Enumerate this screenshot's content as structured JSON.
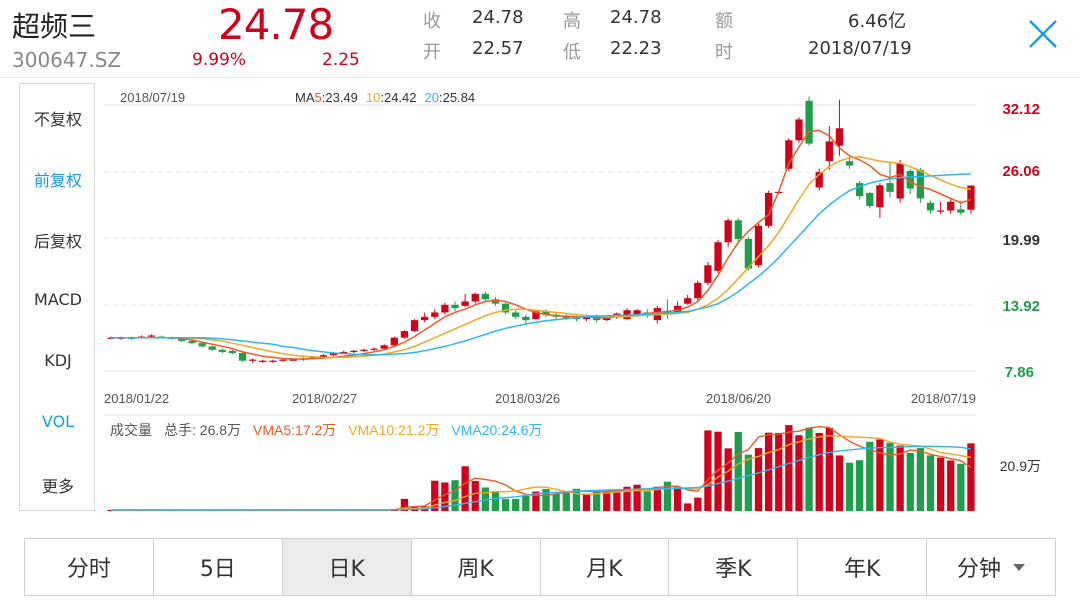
{
  "header": {
    "name": "超频三",
    "code": "300647.SZ",
    "price": "24.78",
    "change_pct": "9.99%",
    "change": "2.25",
    "quotes": [
      {
        "label": "收",
        "value": "24.78"
      },
      {
        "label": "高",
        "value": "24.78"
      },
      {
        "label": "额",
        "value": "6.46亿"
      },
      {
        "label": "开",
        "value": "22.57"
      },
      {
        "label": "低",
        "value": "22.23"
      },
      {
        "label": "时",
        "value": "2018/07/19"
      }
    ],
    "close_icon": "close-icon"
  },
  "sidebar": {
    "items": [
      {
        "label": "不复权",
        "active": false
      },
      {
        "label": "前复权",
        "active": true
      },
      {
        "label": "后复权",
        "active": false
      },
      {
        "label": "MACD",
        "active": false
      },
      {
        "label": "KDJ",
        "active": false
      },
      {
        "label": "VOL",
        "active": true
      },
      {
        "label": "更多",
        "active": false
      }
    ]
  },
  "ma_legend": {
    "date": "2018/07/19",
    "ma5_prefix": "MA",
    "ma5_label": "5",
    "ma5_value": ":23.49",
    "ma10_label": "10",
    "ma10_value": ":24.42",
    "ma20_label": "20",
    "ma20_value": ":25.84"
  },
  "vol_legend": {
    "title": "成交量",
    "hands": "总手: 26.8万",
    "vma5": "VMA5:17.2万",
    "vma10": "VMA10:21.2万",
    "vma20": "VMA20:24.6万"
  },
  "tabs": [
    "分时",
    "5日",
    "日K",
    "周K",
    "月K",
    "季K",
    "年K",
    "分钟"
  ],
  "selected_tab": "日K",
  "colors": {
    "up": "#d0021b",
    "down": "#1e9e4a",
    "ma5": "#ee5a24",
    "ma10": "#f5a623",
    "ma20": "#2db7f5",
    "accent": "#1a9cde"
  },
  "chart_data": {
    "type": "candlestick",
    "y_axis_labels": [
      "32.12",
      "26.06",
      "19.99",
      "13.92",
      "7.86"
    ],
    "ylim": [
      7.86,
      32.12
    ],
    "volume_axis_label": "20.9万",
    "x_axis_labels": [
      "2018/01/22",
      "2018/02/27",
      "2018/03/26",
      "2018/06/20",
      "2018/07/19"
    ],
    "candles": [
      {
        "o": 10.9,
        "c": 10.9,
        "h": 11.0,
        "l": 10.8
      },
      {
        "o": 10.8,
        "c": 10.9,
        "h": 11.0,
        "l": 10.7
      },
      {
        "o": 10.9,
        "c": 10.8,
        "h": 11.0,
        "l": 10.7
      },
      {
        "o": 10.9,
        "c": 11.0,
        "h": 11.1,
        "l": 10.8
      },
      {
        "o": 11.0,
        "c": 11.1,
        "h": 11.2,
        "l": 10.9
      },
      {
        "o": 11.0,
        "c": 10.9,
        "h": 11.1,
        "l": 10.8
      },
      {
        "o": 10.9,
        "c": 10.8,
        "h": 11.0,
        "l": 10.7
      },
      {
        "o": 10.8,
        "c": 10.6,
        "h": 10.9,
        "l": 10.5
      },
      {
        "o": 10.6,
        "c": 10.4,
        "h": 10.7,
        "l": 10.3
      },
      {
        "o": 10.4,
        "c": 10.1,
        "h": 10.5,
        "l": 10.0
      },
      {
        "o": 10.1,
        "c": 9.8,
        "h": 10.2,
        "l": 9.7
      },
      {
        "o": 9.8,
        "c": 9.6,
        "h": 9.9,
        "l": 9.5
      },
      {
        "o": 9.7,
        "c": 9.5,
        "h": 9.8,
        "l": 9.4
      },
      {
        "o": 9.5,
        "c": 8.8,
        "h": 9.6,
        "l": 8.7
      },
      {
        "o": 8.8,
        "c": 8.9,
        "h": 9.0,
        "l": 8.6
      },
      {
        "o": 8.8,
        "c": 8.8,
        "h": 8.9,
        "l": 8.6
      },
      {
        "o": 8.7,
        "c": 8.8,
        "h": 8.9,
        "l": 8.6
      },
      {
        "o": 8.8,
        "c": 8.9,
        "h": 9.0,
        "l": 8.7
      },
      {
        "o": 8.9,
        "c": 8.9,
        "h": 9.0,
        "l": 8.8
      },
      {
        "o": 8.9,
        "c": 9.0,
        "h": 9.1,
        "l": 8.8
      },
      {
        "o": 9.0,
        "c": 9.1,
        "h": 9.2,
        "l": 8.9
      },
      {
        "o": 9.1,
        "c": 9.3,
        "h": 9.4,
        "l": 9.0
      },
      {
        "o": 9.3,
        "c": 9.5,
        "h": 9.6,
        "l": 9.2
      },
      {
        "o": 9.5,
        "c": 9.6,
        "h": 9.7,
        "l": 9.4
      },
      {
        "o": 9.6,
        "c": 9.7,
        "h": 9.8,
        "l": 9.5
      },
      {
        "o": 9.7,
        "c": 9.8,
        "h": 9.9,
        "l": 9.6
      },
      {
        "o": 9.8,
        "c": 9.9,
        "h": 10.0,
        "l": 9.7
      },
      {
        "o": 9.9,
        "c": 10.2,
        "h": 10.3,
        "l": 9.8
      },
      {
        "o": 10.2,
        "c": 10.9,
        "h": 11.0,
        "l": 10.1
      },
      {
        "o": 10.9,
        "c": 11.5,
        "h": 11.6,
        "l": 10.8
      },
      {
        "o": 11.5,
        "c": 12.5,
        "h": 12.6,
        "l": 11.4
      },
      {
        "o": 12.5,
        "c": 12.8,
        "h": 13.2,
        "l": 12.3
      },
      {
        "o": 12.8,
        "c": 13.2,
        "h": 13.5,
        "l": 12.6
      },
      {
        "o": 13.2,
        "c": 13.9,
        "h": 14.1,
        "l": 13.0
      },
      {
        "o": 13.9,
        "c": 13.6,
        "h": 14.2,
        "l": 13.3
      },
      {
        "o": 13.8,
        "c": 14.2,
        "h": 14.9,
        "l": 13.7
      },
      {
        "o": 14.2,
        "c": 14.9,
        "h": 15.0,
        "l": 14.0
      },
      {
        "o": 14.9,
        "c": 14.4,
        "h": 15.1,
        "l": 14.2
      },
      {
        "o": 14.4,
        "c": 14.0,
        "h": 14.6,
        "l": 13.8
      },
      {
        "o": 14.0,
        "c": 13.2,
        "h": 14.1,
        "l": 13.0
      },
      {
        "o": 13.2,
        "c": 12.8,
        "h": 13.4,
        "l": 12.6
      },
      {
        "o": 12.8,
        "c": 12.5,
        "h": 13.0,
        "l": 12.1
      },
      {
        "o": 12.6,
        "c": 13.3,
        "h": 13.4,
        "l": 12.5
      },
      {
        "o": 13.3,
        "c": 13.0,
        "h": 13.5,
        "l": 12.8
      },
      {
        "o": 13.0,
        "c": 12.8,
        "h": 13.2,
        "l": 12.6
      },
      {
        "o": 12.9,
        "c": 12.7,
        "h": 13.0,
        "l": 12.5
      },
      {
        "o": 12.7,
        "c": 12.6,
        "h": 12.9,
        "l": 12.4
      },
      {
        "o": 12.6,
        "c": 12.9,
        "h": 13.0,
        "l": 12.4
      },
      {
        "o": 12.9,
        "c": 12.5,
        "h": 13.0,
        "l": 12.3
      },
      {
        "o": 12.5,
        "c": 12.8,
        "h": 12.9,
        "l": 12.4
      },
      {
        "o": 12.8,
        "c": 13.1,
        "h": 13.2,
        "l": 12.6
      },
      {
        "o": 12.6,
        "c": 13.4,
        "h": 13.6,
        "l": 12.5
      },
      {
        "o": 12.9,
        "c": 13.4,
        "h": 13.5,
        "l": 12.8
      },
      {
        "o": 13.2,
        "c": 13.0,
        "h": 13.5,
        "l": 12.7
      },
      {
        "o": 12.5,
        "c": 13.6,
        "h": 13.8,
        "l": 12.2
      },
      {
        "o": 13.3,
        "c": 13.1,
        "h": 14.4,
        "l": 12.6
      },
      {
        "o": 13.2,
        "c": 13.8,
        "h": 14.2,
        "l": 13.1
      },
      {
        "o": 14.0,
        "c": 14.5,
        "h": 14.8,
        "l": 13.9
      },
      {
        "o": 14.5,
        "c": 15.9,
        "h": 16.1,
        "l": 14.3
      },
      {
        "o": 15.9,
        "c": 17.5,
        "h": 17.8,
        "l": 15.7
      },
      {
        "o": 17.0,
        "c": 19.6,
        "h": 19.8,
        "l": 16.8
      },
      {
        "o": 19.6,
        "c": 21.6,
        "h": 21.8,
        "l": 19.2
      },
      {
        "o": 21.6,
        "c": 19.9,
        "h": 21.8,
        "l": 19.6
      },
      {
        "o": 19.9,
        "c": 17.2,
        "h": 20.1,
        "l": 17.0
      },
      {
        "o": 17.5,
        "c": 21.1,
        "h": 21.3,
        "l": 17.3
      },
      {
        "o": 21.1,
        "c": 24.1,
        "h": 24.3,
        "l": 20.9
      },
      {
        "o": 24.1,
        "c": 24.2,
        "h": 24.3,
        "l": 24.0
      },
      {
        "o": 26.3,
        "c": 28.9,
        "h": 29.1,
        "l": 26.1
      },
      {
        "o": 28.9,
        "c": 30.8,
        "h": 31.0,
        "l": 28.7
      },
      {
        "o": 32.5,
        "c": 28.6,
        "h": 32.9,
        "l": 28.4
      },
      {
        "o": 24.6,
        "c": 26.0,
        "h": 26.3,
        "l": 24.3
      },
      {
        "o": 27.0,
        "c": 28.8,
        "h": 30.2,
        "l": 26.2
      },
      {
        "o": 28.4,
        "c": 30.0,
        "h": 32.6,
        "l": 27.5
      },
      {
        "o": 27.0,
        "c": 26.6,
        "h": 27.3,
        "l": 26.3
      },
      {
        "o": 25.0,
        "c": 23.8,
        "h": 25.2,
        "l": 23.5
      },
      {
        "o": 24.1,
        "c": 22.9,
        "h": 24.2,
        "l": 22.7
      },
      {
        "o": 22.8,
        "c": 24.8,
        "h": 25.0,
        "l": 21.8
      },
      {
        "o": 25.0,
        "c": 24.2,
        "h": 26.9,
        "l": 23.7
      },
      {
        "o": 23.6,
        "c": 26.8,
        "h": 27.1,
        "l": 23.2
      },
      {
        "o": 26.1,
        "c": 24.5,
        "h": 26.3,
        "l": 24.0
      },
      {
        "o": 26.2,
        "c": 23.6,
        "h": 26.4,
        "l": 23.2
      },
      {
        "o": 23.2,
        "c": 22.5,
        "h": 23.4,
        "l": 22.2
      },
      {
        "o": 22.5,
        "c": 22.5,
        "h": 23.3,
        "l": 22.2
      },
      {
        "o": 22.5,
        "c": 23.3,
        "h": 23.5,
        "l": 22.2
      },
      {
        "o": 22.6,
        "c": 22.3,
        "h": 23.4,
        "l": 22.1
      },
      {
        "o": 22.57,
        "c": 24.78,
        "h": 24.78,
        "l": 22.23
      }
    ],
    "ma5": [
      10.9,
      10.9,
      10.9,
      10.9,
      10.9,
      10.9,
      10.9,
      10.8,
      10.7,
      10.5,
      10.3,
      10.1,
      9.9,
      9.6,
      9.4,
      9.2,
      9.1,
      9.0,
      8.95,
      8.95,
      9.0,
      9.05,
      9.1,
      9.2,
      9.3,
      9.45,
      9.6,
      9.8,
      10.1,
      10.5,
      11.0,
      11.6,
      12.2,
      12.8,
      13.2,
      13.5,
      13.9,
      14.2,
      14.3,
      14.2,
      13.9,
      13.5,
      13.2,
      13.0,
      12.9,
      12.85,
      12.8,
      12.8,
      12.7,
      12.7,
      12.8,
      12.9,
      13.0,
      13.1,
      13.2,
      13.3,
      13.4,
      13.7,
      14.2,
      15.2,
      16.6,
      18.2,
      19.6,
      20.6,
      21.4,
      22.1,
      24.2,
      26.8,
      28.3,
      29.7,
      29.8,
      29.3,
      28.2,
      27.5,
      27.1,
      26.6,
      25.8,
      25.5,
      25.8,
      25.1,
      24.7,
      24.4,
      24.0,
      23.6,
      23.2,
      23.49
    ],
    "ma10": [
      10.9,
      10.9,
      10.9,
      10.9,
      10.9,
      10.9,
      10.9,
      10.9,
      10.85,
      10.8,
      10.7,
      10.6,
      10.4,
      10.2,
      10.0,
      9.8,
      9.6,
      9.45,
      9.3,
      9.2,
      9.15,
      9.1,
      9.1,
      9.1,
      9.15,
      9.2,
      9.3,
      9.4,
      9.6,
      9.8,
      10.1,
      10.5,
      10.9,
      11.3,
      11.7,
      12.1,
      12.5,
      12.9,
      13.2,
      13.4,
      13.5,
      13.5,
      13.4,
      13.3,
      13.2,
      13.1,
      13.0,
      12.9,
      12.9,
      12.8,
      12.8,
      12.8,
      12.9,
      12.95,
      13.0,
      13.05,
      13.1,
      13.2,
      13.5,
      13.9,
      14.5,
      15.3,
      16.3,
      17.3,
      18.3,
      19.3,
      20.5,
      22.0,
      23.5,
      24.9,
      25.8,
      26.5,
      27.0,
      27.3,
      27.4,
      27.2,
      27.0,
      26.9,
      26.8,
      26.5,
      26.1,
      25.7,
      25.3,
      24.9,
      24.6,
      24.42
    ],
    "ma20": [
      10.9,
      10.9,
      10.9,
      10.9,
      10.9,
      10.9,
      10.9,
      10.9,
      10.9,
      10.9,
      10.85,
      10.8,
      10.7,
      10.6,
      10.5,
      10.4,
      10.3,
      10.1,
      10.0,
      9.85,
      9.7,
      9.6,
      9.5,
      9.45,
      9.4,
      9.35,
      9.35,
      9.35,
      9.4,
      9.45,
      9.55,
      9.7,
      9.9,
      10.1,
      10.35,
      10.6,
      10.9,
      11.2,
      11.5,
      11.75,
      11.95,
      12.15,
      12.3,
      12.45,
      12.55,
      12.65,
      12.75,
      12.8,
      12.85,
      12.9,
      12.95,
      12.95,
      13.0,
      13.05,
      13.1,
      13.15,
      13.2,
      13.3,
      13.5,
      13.7,
      14.0,
      14.5,
      15.1,
      15.8,
      16.5,
      17.3,
      18.2,
      19.2,
      20.2,
      21.2,
      22.2,
      23.0,
      23.7,
      24.3,
      24.7,
      25.0,
      25.2,
      25.4,
      25.5,
      25.55,
      25.6,
      25.65,
      25.7,
      25.75,
      25.8,
      25.84
    ],
    "volumes": [
      0.4,
      0.4,
      0.4,
      0.4,
      0.4,
      0.4,
      0.4,
      0.4,
      0.4,
      0.4,
      0.4,
      0.4,
      0.4,
      0.4,
      0.4,
      0.4,
      0.4,
      0.4,
      0.4,
      0.4,
      0.4,
      0.4,
      0.4,
      0.4,
      0.4,
      0.4,
      0.4,
      0.5,
      0.8,
      4.8,
      2.0,
      1.9,
      12.0,
      11.3,
      12.2,
      17.7,
      11.9,
      9.3,
      7.8,
      4.8,
      4.8,
      6.0,
      7.7,
      8.7,
      6.8,
      7.8,
      8.8,
      6.8,
      7.8,
      7.9,
      8.4,
      9.6,
      10.4,
      7.8,
      9.6,
      11.6,
      9.6,
      3.0,
      5.3,
      31.9,
      31.4,
      24.8,
      31.3,
      22.3,
      24.9,
      31.0,
      30.9,
      34.0,
      30.0,
      33.0,
      30.9,
      32.9,
      22.0,
      19.1,
      20.1,
      27.4,
      28.3,
      27.0,
      25.9,
      23.0,
      24.9,
      22.0,
      21.1,
      20.0,
      18.7,
      26.8
    ],
    "vma5": [
      0.4,
      0.4,
      0.4,
      0.4,
      0.4,
      0.4,
      0.4,
      0.4,
      0.4,
      0.4,
      0.4,
      0.4,
      0.4,
      0.4,
      0.4,
      0.4,
      0.4,
      0.4,
      0.4,
      0.4,
      0.4,
      0.4,
      0.4,
      0.4,
      0.4,
      0.4,
      0.4,
      0.4,
      0.5,
      1.4,
      1.7,
      2.0,
      4.3,
      6.5,
      8.0,
      11.0,
      13.0,
      12.5,
      11.8,
      10.3,
      7.9,
      6.6,
      6.1,
      6.2,
      6.8,
      7.4,
      7.9,
      7.8,
      7.6,
      7.8,
      7.9,
      8.1,
      8.7,
      8.8,
      9.2,
      9.8,
      9.8,
      8.3,
      7.8,
      12.3,
      16.2,
      19.0,
      22.6,
      24.3,
      29.3,
      30.2,
      30.4,
      31.2,
      31.6,
      32.8,
      33.4,
      33.0,
      30.2,
      27.6,
      25.6,
      24.4,
      23.0,
      22.2,
      22.5,
      24.1,
      23.8,
      22.4,
      21.6,
      20.7,
      19.9,
      17.2
    ],
    "vma10": [
      0.4,
      0.4,
      0.4,
      0.4,
      0.4,
      0.4,
      0.4,
      0.4,
      0.4,
      0.4,
      0.4,
      0.4,
      0.4,
      0.4,
      0.4,
      0.4,
      0.4,
      0.4,
      0.4,
      0.4,
      0.4,
      0.4,
      0.4,
      0.4,
      0.4,
      0.4,
      0.4,
      0.4,
      0.5,
      0.9,
      1.0,
      1.2,
      2.3,
      3.4,
      4.2,
      5.7,
      7.0,
      7.2,
      7.7,
      7.6,
      7.9,
      8.8,
      9.5,
      9.4,
      8.6,
      7.6,
      6.9,
      6.6,
      6.8,
      7.1,
      7.5,
      7.8,
      8.1,
      8.2,
      8.5,
      8.9,
      9.2,
      8.9,
      8.6,
      10.5,
      13.4,
      15.8,
      18.7,
      20.5,
      21.6,
      23.1,
      24.3,
      26.3,
      27.4,
      28.5,
      29.3,
      29.8,
      29.6,
      29.4,
      29.2,
      29.0,
      28.7,
      27.3,
      26.4,
      26.0,
      25.7,
      24.5,
      23.1,
      22.6,
      21.9,
      21.2
    ],
    "vma20": [
      0.4,
      0.4,
      0.4,
      0.4,
      0.4,
      0.4,
      0.4,
      0.4,
      0.4,
      0.4,
      0.4,
      0.4,
      0.4,
      0.4,
      0.4,
      0.4,
      0.4,
      0.4,
      0.4,
      0.4,
      0.4,
      0.4,
      0.4,
      0.4,
      0.4,
      0.4,
      0.4,
      0.4,
      0.5,
      0.6,
      0.7,
      0.8,
      1.3,
      1.8,
      2.3,
      3.0,
      3.7,
      4.3,
      4.9,
      5.3,
      5.6,
      6.2,
      6.8,
      7.2,
      7.4,
      7.6,
      7.9,
      8.0,
      8.1,
      8.3,
      8.4,
      8.5,
      8.6,
      8.7,
      8.8,
      8.9,
      9.0,
      9.1,
      9.3,
      9.9,
      10.9,
      11.8,
      12.9,
      14.0,
      15.1,
      16.3,
      17.5,
      18.8,
      20.0,
      21.2,
      22.3,
      23.1,
      23.8,
      24.2,
      24.6,
      24.9,
      25.1,
      25.1,
      25.3,
      25.5,
      25.6,
      25.6,
      25.5,
      25.4,
      25.2,
      24.6
    ],
    "ylim_volume": [
      0,
      38
    ]
  }
}
